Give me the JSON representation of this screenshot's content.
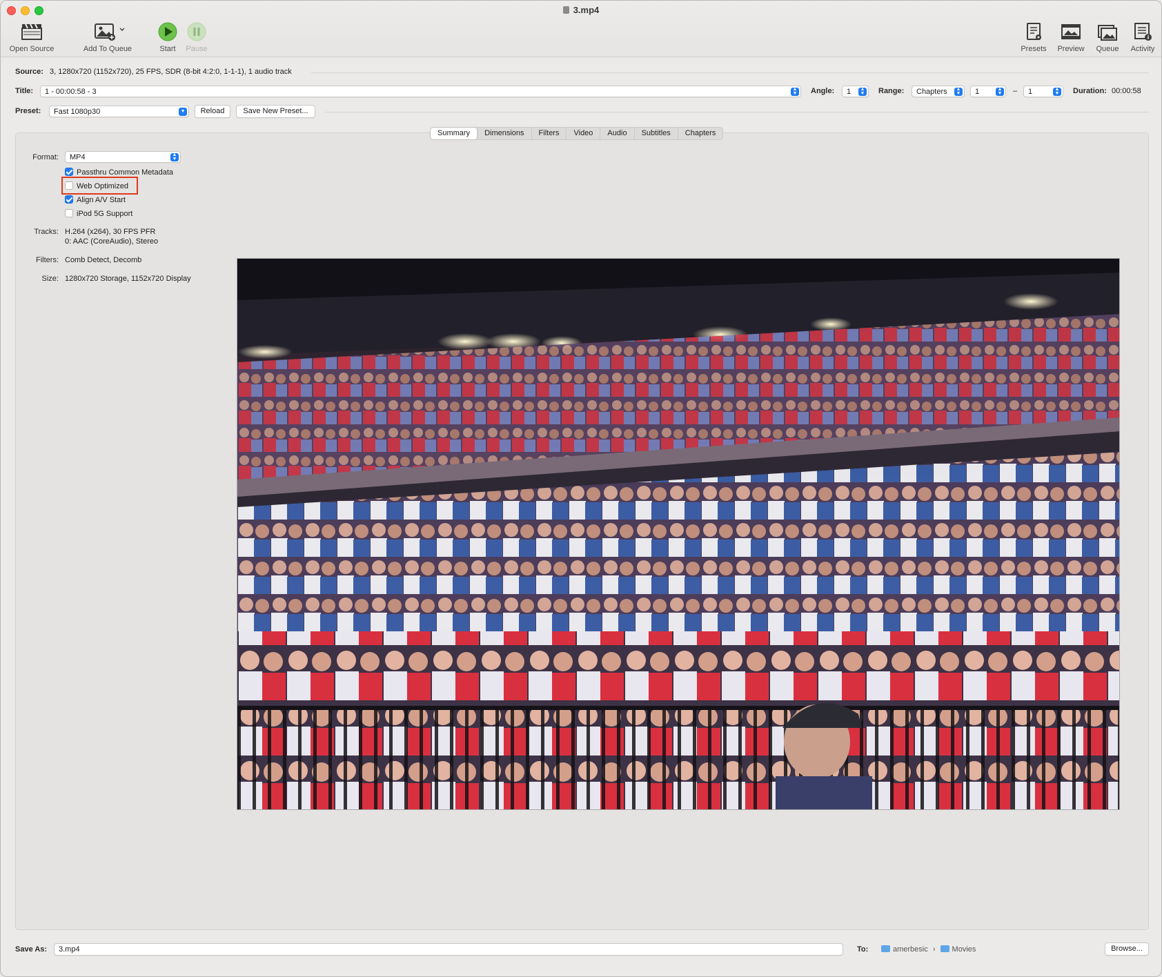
{
  "window": {
    "title": "3.mp4"
  },
  "toolbar": {
    "open_source": "Open Source",
    "add_to_queue": "Add To Queue",
    "start": "Start",
    "pause": "Pause",
    "presets": "Presets",
    "preview": "Preview",
    "queue": "Queue",
    "activity": "Activity"
  },
  "source": {
    "label": "Source:",
    "value": "3, 1280x720 (1152x720), 25 FPS, SDR (8-bit 4:2:0, 1-1-1), 1 audio track"
  },
  "title_row": {
    "label": "Title:",
    "value": "1 - 00:00:58 - 3",
    "angle_label": "Angle:",
    "angle_value": "1",
    "range_label": "Range:",
    "range_type": "Chapters",
    "range_start": "1",
    "range_sep": "–",
    "range_end": "1",
    "duration_label": "Duration:",
    "duration_value": "00:00:58"
  },
  "preset_row": {
    "label": "Preset:",
    "value": "Fast 1080p30",
    "reload": "Reload",
    "save_new": "Save New Preset..."
  },
  "tabs": [
    "Summary",
    "Dimensions",
    "Filters",
    "Video",
    "Audio",
    "Subtitles",
    "Chapters"
  ],
  "summary": {
    "format_label": "Format:",
    "format_value": "MP4",
    "options": [
      {
        "label": "Passthru Common Metadata",
        "checked": true
      },
      {
        "label": "Web Optimized",
        "checked": false
      },
      {
        "label": "Align A/V Start",
        "checked": true
      },
      {
        "label": "iPod 5G Support",
        "checked": false
      }
    ],
    "tracks_label": "Tracks:",
    "tracks_line1": "H.264 (x264), 30 FPS PFR",
    "tracks_line2": "0: AAC (CoreAudio), Stereo",
    "filters_label": "Filters:",
    "filters_value": "Comb Detect, Decomb",
    "size_label": "Size:",
    "size_value": "1280x720 Storage, 1152x720 Display"
  },
  "save": {
    "label": "Save As:",
    "value": "3.mp4",
    "to_label": "To:",
    "path_1": "amerbesic",
    "path_sep": "›",
    "path_2": "Movies",
    "browse": "Browse..."
  },
  "colors": {
    "accent": "#1f7cf3",
    "highlight": "#e0391f"
  }
}
